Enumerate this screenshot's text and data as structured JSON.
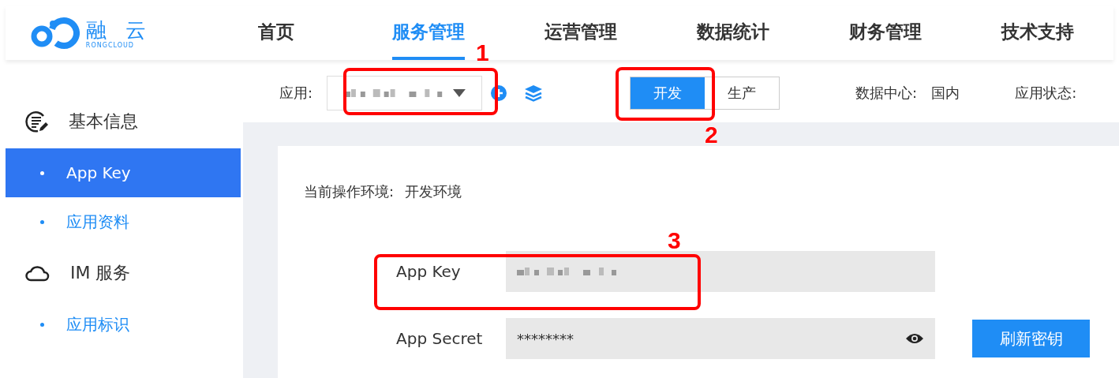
{
  "header": {
    "logo": {
      "name": "融 云",
      "sub": "RONGCLOUD"
    },
    "nav": [
      {
        "label": "首页",
        "selected": false
      },
      {
        "label": "服务管理",
        "selected": true
      },
      {
        "label": "运营管理",
        "selected": false
      },
      {
        "label": "数据统计",
        "selected": false
      },
      {
        "label": "财务管理",
        "selected": false
      },
      {
        "label": "技术支持",
        "selected": false
      }
    ]
  },
  "sidebar": [
    {
      "label": "基本信息",
      "children": [
        {
          "label": "App Key",
          "selected": true
        },
        {
          "label": "应用资料",
          "selected": false
        }
      ]
    },
    {
      "label": "IM 服务",
      "children": [
        {
          "label": "应用标识",
          "selected": false
        }
      ]
    }
  ],
  "toolbar": {
    "app_label": "应用:",
    "environments": [
      {
        "label": "开发",
        "selected": true
      },
      {
        "label": "生产",
        "selected": false
      }
    ],
    "data_center_label": "数据中心:",
    "data_center": "国内",
    "app_status_label": "应用状态:"
  },
  "card": {
    "env_label": "当前操作环境:",
    "env_value": "开发环境",
    "fields": [
      {
        "label": "App Key",
        "kind": "blurred"
      },
      {
        "label": "App Secret",
        "kind": "masked",
        "value": "********"
      }
    ],
    "refresh_button": "刷新密钥"
  },
  "annotations": [
    "1",
    "2",
    "3"
  ]
}
